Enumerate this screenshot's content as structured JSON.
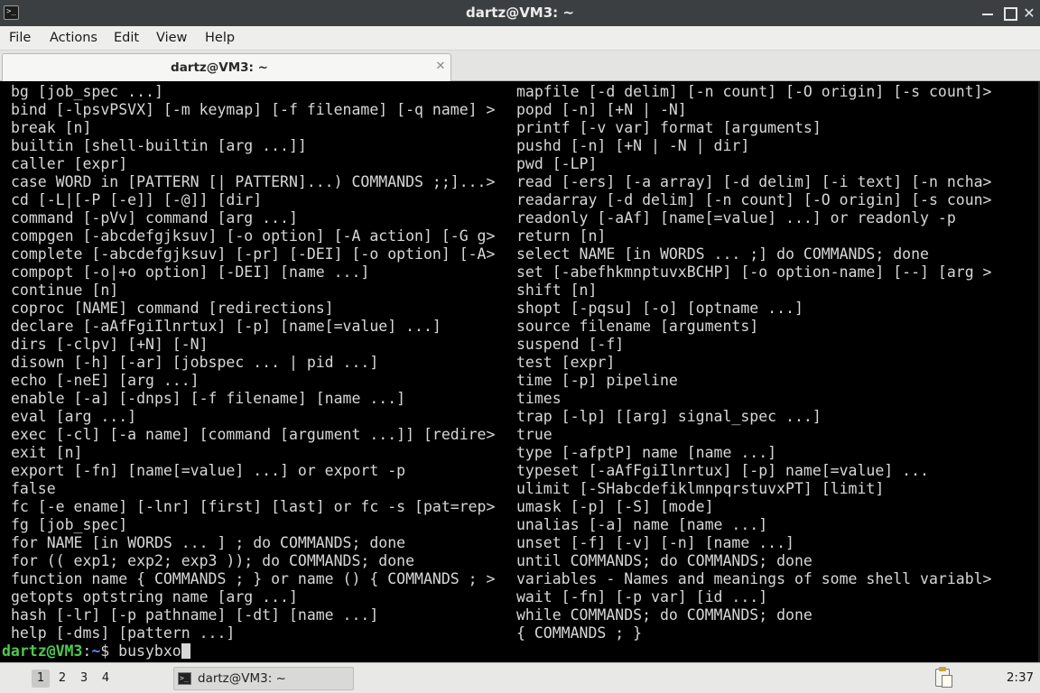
{
  "window": {
    "title": "dartz@VM3: ~",
    "app_icon": "terminal-icon"
  },
  "menu": [
    "File",
    "Actions",
    "Edit",
    "View",
    "Help"
  ],
  "tab": {
    "label": "dartz@VM3: ~",
    "close_glyph": "✕"
  },
  "terminal": {
    "left_column": [
      "bg [job_spec ...]",
      "bind [-lpsvPSVX] [-m keymap] [-f filename] [-q name] >",
      "break [n]",
      "builtin [shell-builtin [arg ...]]",
      "caller [expr]",
      "case WORD in [PATTERN [| PATTERN]...) COMMANDS ;;]...>",
      "cd [-L|[-P [-e]] [-@]] [dir]",
      "command [-pVv] command [arg ...]",
      "compgen [-abcdefgjksuv] [-o option] [-A action] [-G g>",
      "complete [-abcdefgjksuv] [-pr] [-DEI] [-o option] [-A>",
      "compopt [-o|+o option] [-DEI] [name ...]",
      "continue [n]",
      "coproc [NAME] command [redirections]",
      "declare [-aAfFgiIlnrtux] [-p] [name[=value] ...]",
      "dirs [-clpv] [+N] [-N]",
      "disown [-h] [-ar] [jobspec ... | pid ...]",
      "echo [-neE] [arg ...]",
      "enable [-a] [-dnps] [-f filename] [name ...]",
      "eval [arg ...]",
      "exec [-cl] [-a name] [command [argument ...]] [redire>",
      "exit [n]",
      "export [-fn] [name[=value] ...] or export -p",
      "false",
      "fc [-e ename] [-lnr] [first] [last] or fc -s [pat=rep>",
      "fg [job_spec]",
      "for NAME [in WORDS ... ] ; do COMMANDS; done",
      "for (( exp1; exp2; exp3 )); do COMMANDS; done",
      "function name { COMMANDS ; } or name () { COMMANDS ; >",
      "getopts optstring name [arg ...]",
      "hash [-lr] [-p pathname] [-dt] [name ...]",
      "help [-dms] [pattern ...]"
    ],
    "right_column": [
      "mapfile [-d delim] [-n count] [-O origin] [-s count]>",
      "popd [-n] [+N | -N]",
      "printf [-v var] format [arguments]",
      "pushd [-n] [+N | -N | dir]",
      "pwd [-LP]",
      "read [-ers] [-a array] [-d delim] [-i text] [-n ncha>",
      "readarray [-d delim] [-n count] [-O origin] [-s coun>",
      "readonly [-aAf] [name[=value] ...] or readonly -p",
      "return [n]",
      "select NAME [in WORDS ... ;] do COMMANDS; done",
      "set [-abefhkmnptuvxBCHP] [-o option-name] [--] [arg >",
      "shift [n]",
      "shopt [-pqsu] [-o] [optname ...]",
      "source filename [arguments]",
      "suspend [-f]",
      "test [expr]",
      "time [-p] pipeline",
      "times",
      "trap [-lp] [[arg] signal_spec ...]",
      "true",
      "type [-afptP] name [name ...]",
      "typeset [-aAfFgiIlnrtux] [-p] name[=value] ...",
      "ulimit [-SHabcdefiklmnpqrstuvxPT] [limit]",
      "umask [-p] [-S] [mode]",
      "unalias [-a] name [name ...]",
      "unset [-f] [-v] [-n] [name ...]",
      "until COMMANDS; do COMMANDS; done",
      "variables - Names and meanings of some shell variabl>",
      "wait [-fn] [-p var] [id ...]",
      "while COMMANDS; do COMMANDS; done",
      "{ COMMANDS ; }"
    ],
    "prompt": {
      "user_host": "dartz@VM3",
      "separator": ":",
      "path": "~",
      "symbol": "$ ",
      "command": "busybxo"
    }
  },
  "taskbar": {
    "workspaces": [
      "1",
      "2",
      "3",
      "4"
    ],
    "active_workspace": "1",
    "task_label": "dartz@VM3: ~",
    "tray_icon": "clipboard-icon",
    "clock": "2:37"
  },
  "colors": {
    "terminal_bg": "#000000",
    "terminal_fg": "#d7d7d7",
    "prompt_user": "#4ec94e",
    "prompt_path": "#5a8fe6"
  }
}
